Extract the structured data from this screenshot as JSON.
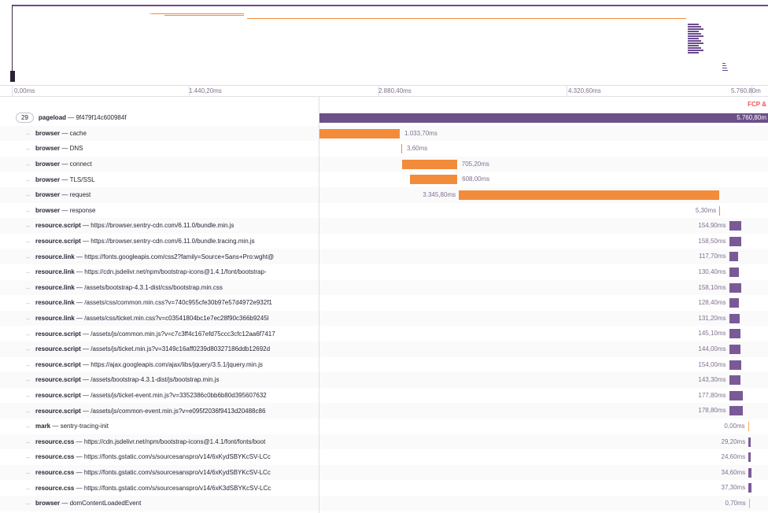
{
  "colors": {
    "root": "#6c5088",
    "browser": "#f28c3b",
    "resource": "#7a5a96",
    "mark": "#f2ad5c",
    "fcp": "#f55459",
    "minimap_orange": "#f28c3b",
    "minimap_purple": "#6b4b8f"
  },
  "ruler": {
    "ticks": [
      "0,00ms",
      "1.440,20ms",
      "2.880,40ms",
      "4.320,60ms",
      "5.760,80m"
    ]
  },
  "markers": {
    "fcp_label": "FCP &"
  },
  "root": {
    "count": "29",
    "op": "pageload",
    "desc": "9f479f14c600984f",
    "duration": "5.760,80m"
  },
  "spans": [
    {
      "op": "browser",
      "desc": "cache",
      "duration": "1.033,70ms",
      "start": 0.0,
      "dur": 0.179,
      "kind": "browser",
      "label_pos": "right"
    },
    {
      "op": "browser",
      "desc": "DNS",
      "duration": "3,60ms",
      "start": 0.1825,
      "dur": 0.0008,
      "kind": "browser",
      "label_pos": "right"
    },
    {
      "op": "browser",
      "desc": "connect",
      "duration": "705,20ms",
      "start": 0.1842,
      "dur": 0.1224,
      "kind": "browser",
      "label_pos": "right"
    },
    {
      "op": "browser",
      "desc": "TLS/SSL",
      "duration": "608,00ms",
      "start": 0.2018,
      "dur": 0.1055,
      "kind": "browser",
      "label_pos": "right"
    },
    {
      "op": "browser",
      "desc": "request",
      "duration": "3.345,80ms",
      "start": 0.3107,
      "dur": 0.5807,
      "kind": "browser",
      "label_pos": "left"
    },
    {
      "op": "browser",
      "desc": "response",
      "duration": "5,30ms",
      "start": 0.8914,
      "dur": 0.0009,
      "kind": "browser",
      "label_pos": "left"
    },
    {
      "op": "resource.script",
      "desc": "https://browser.sentry-cdn.com/6.11.0/bundle.min.js",
      "duration": "154,90ms",
      "start": 0.9132,
      "dur": 0.0269,
      "kind": "resource",
      "label_pos": "left"
    },
    {
      "op": "resource.script",
      "desc": "https://browser.sentry-cdn.com/6.11.0/bundle.tracing.min.js",
      "duration": "158,50ms",
      "start": 0.9132,
      "dur": 0.0275,
      "kind": "resource",
      "label_pos": "left"
    },
    {
      "op": "resource.link",
      "desc": "https://fonts.googleapis.com/css2?family=Source+Sans+Pro:wght@",
      "duration": "117,70ms",
      "start": 0.9132,
      "dur": 0.0204,
      "kind": "resource",
      "label_pos": "left"
    },
    {
      "op": "resource.link",
      "desc": "https://cdn.jsdelivr.net/npm/bootstrap-icons@1.4.1/font/bootstrap-",
      "duration": "130,40ms",
      "start": 0.9132,
      "dur": 0.0226,
      "kind": "resource",
      "label_pos": "left"
    },
    {
      "op": "resource.link",
      "desc": "/assets/bootstrap-4.3.1-dist/css/bootstrap.min.css",
      "duration": "158,10ms",
      "start": 0.9132,
      "dur": 0.0274,
      "kind": "resource",
      "label_pos": "left"
    },
    {
      "op": "resource.link",
      "desc": "/assets/css/common.min.css?v=740c955cfe30b97e57d4972e932f1",
      "duration": "128,40ms",
      "start": 0.9132,
      "dur": 0.0223,
      "kind": "resource",
      "label_pos": "left"
    },
    {
      "op": "resource.link",
      "desc": "/assets/css/ticket.min.css?v=c03541804bc1e7ec28f90c366b9245l",
      "duration": "131,20ms",
      "start": 0.9132,
      "dur": 0.0228,
      "kind": "resource",
      "label_pos": "left"
    },
    {
      "op": "resource.script",
      "desc": "/assets/js/common.min.js?v=c7c3ff4c167efd75ccc3cfc12aa6f7417",
      "duration": "145,10ms",
      "start": 0.9132,
      "dur": 0.0252,
      "kind": "resource",
      "label_pos": "left"
    },
    {
      "op": "resource.script",
      "desc": "/assets/js/ticket.min.js?v=3149c16aff0239d80327186ddb12692d",
      "duration": "144,00ms",
      "start": 0.9132,
      "dur": 0.025,
      "kind": "resource",
      "label_pos": "left"
    },
    {
      "op": "resource.script",
      "desc": "https://ajax.googleapis.com/ajax/libs/jquery/3.5.1/jquery.min.js",
      "duration": "154,00ms",
      "start": 0.9132,
      "dur": 0.0267,
      "kind": "resource",
      "label_pos": "left"
    },
    {
      "op": "resource.script",
      "desc": "/assets/bootstrap-4.3.1-dist/js/bootstrap.min.js",
      "duration": "143,30ms",
      "start": 0.9132,
      "dur": 0.0249,
      "kind": "resource",
      "label_pos": "left"
    },
    {
      "op": "resource.script",
      "desc": "/assets/js/ticket-event.min.js?v=3352386c0bb6b80d395607632",
      "duration": "177,80ms",
      "start": 0.9132,
      "dur": 0.0309,
      "kind": "resource",
      "label_pos": "left"
    },
    {
      "op": "resource.script",
      "desc": "/assets/js/common-event.min.js?v=e095f2036f9413d20488c86",
      "duration": "178,80ms",
      "start": 0.9132,
      "dur": 0.031,
      "kind": "resource",
      "label_pos": "left"
    },
    {
      "op": "mark",
      "desc": "sentry-tracing-init",
      "duration": "0,00ms",
      "start": 0.9555,
      "dur": 0.0,
      "kind": "mark",
      "label_pos": "left"
    },
    {
      "op": "resource.css",
      "desc": "https://cdn.jsdelivr.net/npm/bootstrap-icons@1.4.1/font/fonts/boot",
      "duration": "29,20ms",
      "start": 0.9565,
      "dur": 0.0051,
      "kind": "resource",
      "label_pos": "left"
    },
    {
      "op": "resource.css",
      "desc": "https://fonts.gstatic.com/s/sourcesanspro/v14/6xKydSBYKcSV-LCc",
      "duration": "24,60ms",
      "start": 0.9565,
      "dur": 0.0043,
      "kind": "resource",
      "label_pos": "left"
    },
    {
      "op": "resource.css",
      "desc": "https://fonts.gstatic.com/s/sourcesanspro/v14/6xKydSBYKcSV-LCc",
      "duration": "34,60ms",
      "start": 0.9565,
      "dur": 0.006,
      "kind": "resource",
      "label_pos": "left"
    },
    {
      "op": "resource.css",
      "desc": "https://fonts.gstatic.com/s/sourcesanspro/v14/6xK3dSBYKcSV-LCc",
      "duration": "37,30ms",
      "start": 0.9565,
      "dur": 0.0065,
      "kind": "resource",
      "label_pos": "left"
    },
    {
      "op": "browser",
      "desc": "domContentLoadedEvent",
      "duration": "0,70ms",
      "start": 0.9575,
      "dur": 0.0001,
      "kind": "mark",
      "label_pos": "left"
    }
  ]
}
